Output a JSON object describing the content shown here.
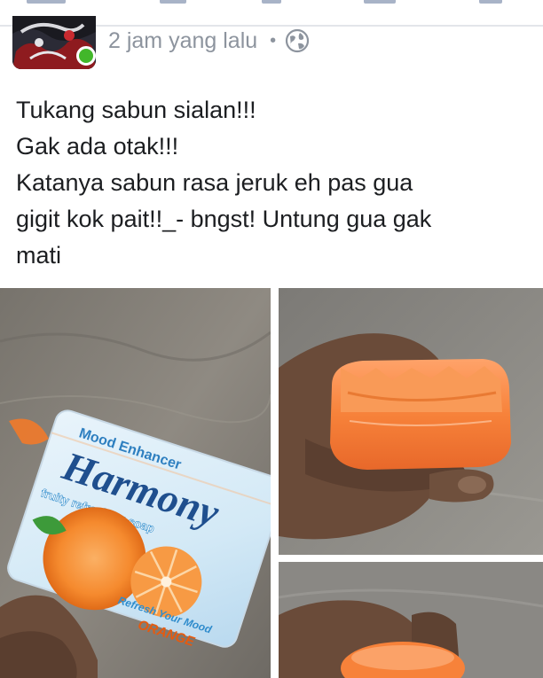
{
  "post": {
    "timestamp": "2 jam yang lalu",
    "separator": "•",
    "privacy_icon": "globe-icon",
    "text_lines": [
      "Tukang sabun sialan!!!",
      "Gak ada otak!!!",
      "Katanya sabun rasa jeruk eh pas gua",
      "gigit kok pait!!_- bngst! Untung gua gak",
      "mati"
    ]
  },
  "photos": {
    "soap_pack": {
      "brand": "Harmony",
      "tagline": "Mood Enhancer",
      "subline": "fruity refreshing soap",
      "slogan": "Refresh Your Mood",
      "variant": "ORANGE"
    }
  },
  "colors": {
    "online": "#42b72a",
    "meta_text": "#8d949e",
    "body_text": "#1c1e21",
    "soap_orange": "#f7823a"
  }
}
